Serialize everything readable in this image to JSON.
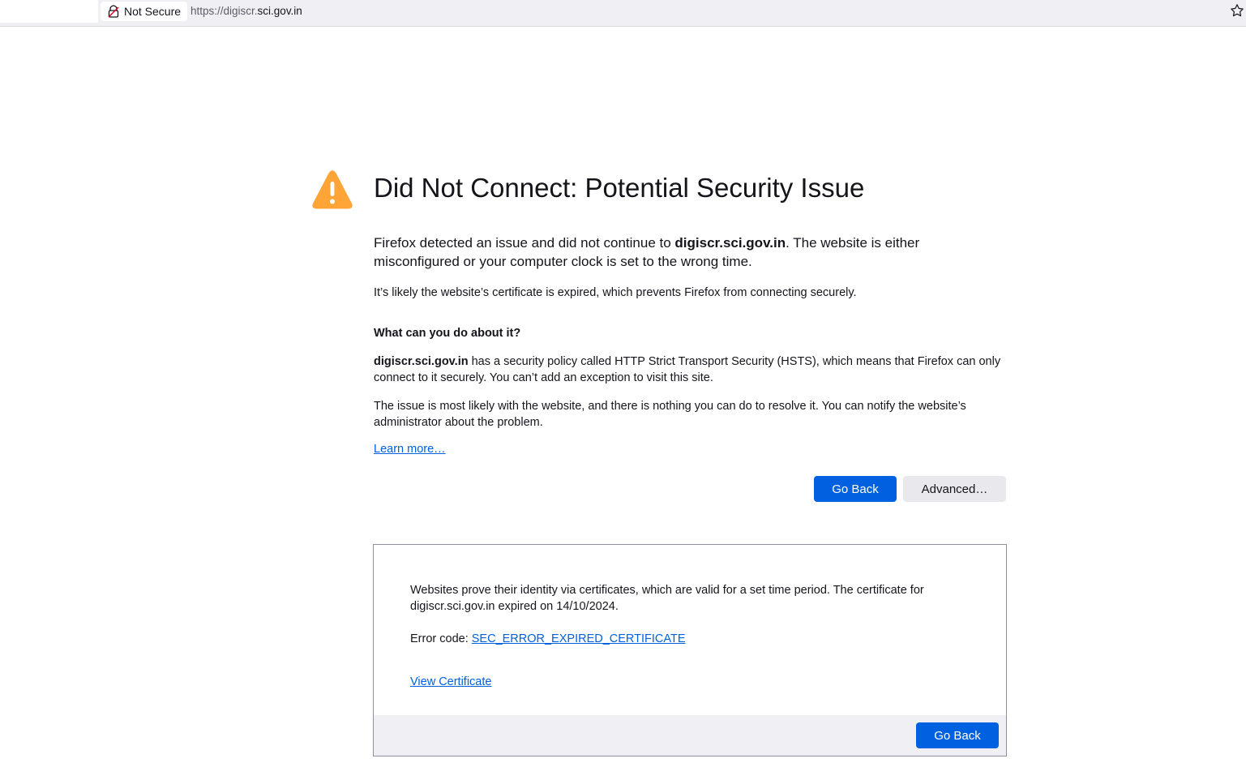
{
  "urlbar": {
    "identity_label": "Not Secure",
    "url_scheme": "https://digiscr.",
    "url_host": "sci.gov.in",
    "lock_icon": "lock-warning-icon",
    "bookmark_icon": "star-icon"
  },
  "error": {
    "icon": "warning-triangle-icon",
    "title": "Did Not Connect: Potential Security Issue",
    "lead_before": "Firefox detected an issue and did not continue to ",
    "lead_host": "digiscr.sci.gov.in",
    "lead_after": ". The website is either misconfigured or your computer clock is set to the wrong time.",
    "likely": "It’s likely the website’s certificate is expired, which prevents Firefox from connecting securely.",
    "what_heading": "What can you do about it?",
    "hsts_host": "digiscr.sci.gov.in",
    "hsts_text": " has a security policy called HTTP Strict Transport Security (HSTS), which means that Firefox can only connect to it securely. You can’t add an exception to visit this site.",
    "issue_text": "The issue is most likely with the website, and there is nothing you can do to resolve it. You can notify the website’s administrator about the problem.",
    "learn_more": "Learn more…",
    "go_back": "Go Back",
    "advanced": "Advanced…"
  },
  "advanced_panel": {
    "description": "Websites prove their identity via certificates, which are valid for a set time period. The certificate for digiscr.sci.gov.in expired on 14/10/2024.",
    "error_code_label": "Error code: ",
    "error_code": "SEC_ERROR_EXPIRED_CERTIFICATE",
    "view_certificate": "View Certificate",
    "go_back": "Go Back"
  },
  "colors": {
    "accent": "#0061e0",
    "warning": "#ffa436"
  }
}
